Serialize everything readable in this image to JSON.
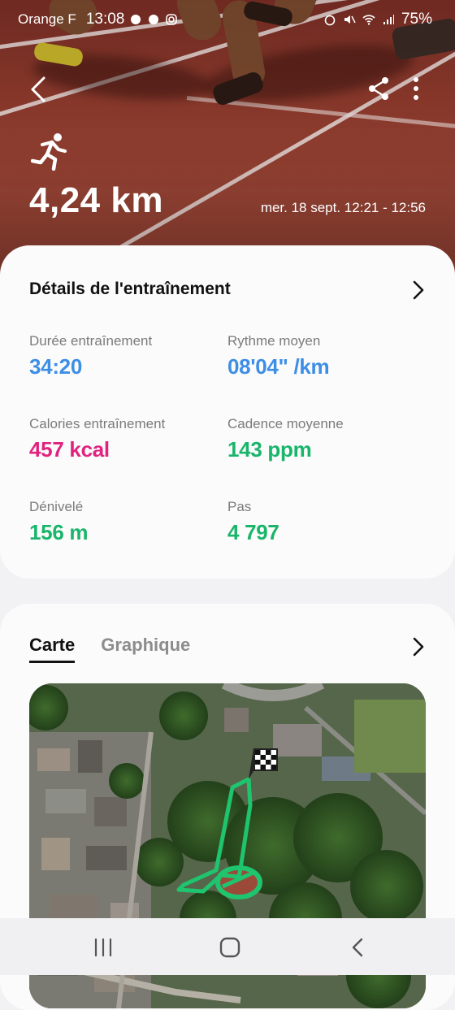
{
  "status_bar": {
    "carrier": "Orange F",
    "time": "13:08",
    "battery": "75%"
  },
  "workout": {
    "distance": "4,24 km",
    "datetime": "mer. 18 sept. 12:21 - 12:56",
    "activity_icon": "running-icon"
  },
  "details": {
    "title": "Détails de l'entraînement",
    "stats": [
      {
        "label": "Durée entraînement",
        "value": "34:20",
        "color": "#3d8ee6"
      },
      {
        "label": "Rythme moyen",
        "value": "08'04\" /km",
        "color": "#3d8ee6"
      },
      {
        "label": "Calories entraînement",
        "value": "457 kcal",
        "color": "#e0237f"
      },
      {
        "label": "Cadence moyenne",
        "value": "143 ppm",
        "color": "#18b56a"
      },
      {
        "label": "Dénivelé",
        "value": "156 m",
        "color": "#18b56a"
      },
      {
        "label": "Pas",
        "value": "4 797",
        "color": "#18b56a"
      }
    ]
  },
  "map_section": {
    "tabs": [
      {
        "label": "Carte",
        "active": true
      },
      {
        "label": "Graphique",
        "active": false
      }
    ],
    "route_color": "#1fc46f",
    "finish_marker": "checkered-flag-icon"
  },
  "icons": {
    "back": "back-arrow-icon",
    "share": "share-icon",
    "more": "more-vertical-icon",
    "chevron": "chevron-right-icon",
    "nav_recent": "recent-apps-icon",
    "nav_home": "home-icon",
    "nav_back": "nav-back-icon"
  }
}
